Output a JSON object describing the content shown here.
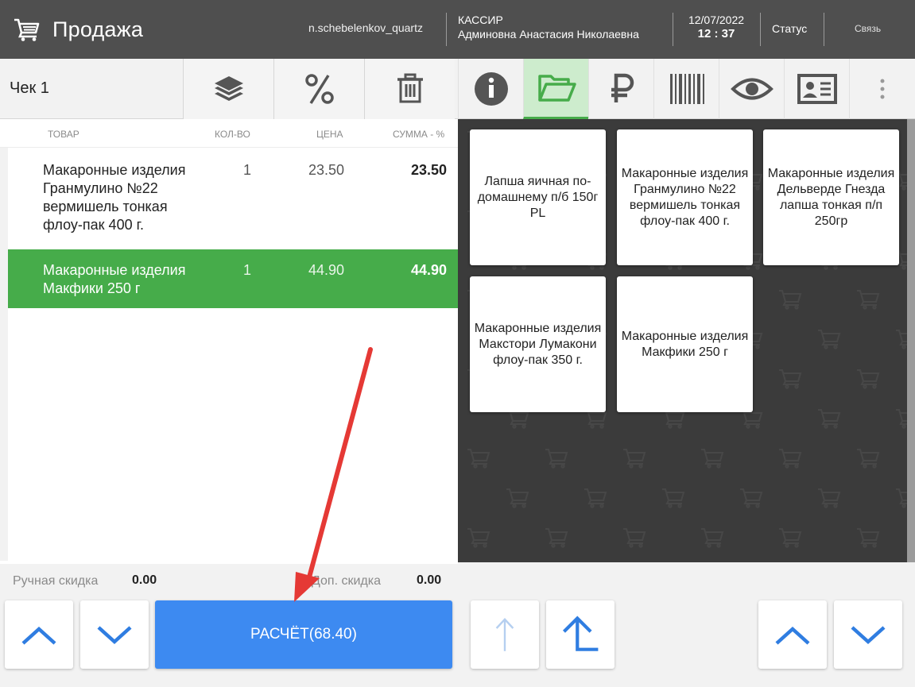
{
  "header": {
    "title": "Продажа",
    "user_login": "n.schebelenkov_quartz",
    "cashier_role": "КАССИР",
    "cashier_name": "Админовна Анастасия Николаевна",
    "date": "12/07/2022",
    "time": "12 : 37",
    "status_label": "Статус",
    "link_label": "Связь"
  },
  "receipt": {
    "title": "Чек 1",
    "columns": {
      "item": "ТОВАР",
      "qty": "КОЛ-ВО",
      "price": "ЦЕНА",
      "sum": "СУММА - %"
    },
    "rows": [
      {
        "name": "Макаронные изделия Гранмулино №22 вермишель тонкая флоу-пак 400 г.",
        "qty": "1",
        "price": "23.50",
        "sum": "23.50",
        "selected": false
      },
      {
        "name": "Макаронные изделия Макфики 250 г",
        "qty": "1",
        "price": "44.90",
        "sum": "44.90",
        "selected": true
      }
    ],
    "manual_discount_label": "Ручная скидка",
    "manual_discount_value": "0.00",
    "extra_discount_label": "Доп. скидка",
    "extra_discount_value": "0.00",
    "pay_button": "РАСЧЁТ(68.40)"
  },
  "toolbar_icons": [
    "layers-icon",
    "percent-icon",
    "trash-icon"
  ],
  "tabs": [
    "info-icon",
    "folder-open-icon",
    "ruble-icon",
    "barcode-icon",
    "eye-icon",
    "id-card-icon",
    "more-vertical-icon"
  ],
  "products": [
    "Лапша яичная по-домашнему п/б 150г PL",
    "Макаронные изделия Гранмулино №22 вермишель тонкая флоу-пак 400 г.",
    "Макаронные изделия Дельверде Гнезда лапша тонкая п/п 250гр",
    "Макаронные изделия Макстори Лумакони флоу-пак 350 г.",
    "Макаронные изделия Макфики 250 г"
  ],
  "colors": {
    "header_bg": "#4f4f4f",
    "selected_row": "#46ac4a",
    "pay_button": "#3d8af1",
    "arrow_blue": "#2f7de1",
    "grid_bg": "#3b3b3b",
    "annotation_arrow": "#e53935"
  }
}
